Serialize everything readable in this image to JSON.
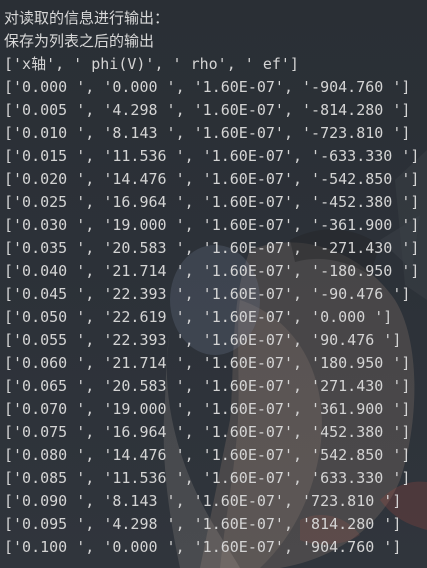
{
  "console": {
    "intro_lines": [
      "对读取的信息进行输出：",
      "保存为列表之后的输出"
    ],
    "rows": [
      "['x轴', ' phi(V)', ' rho', ' ef']",
      "['0.000 ', '0.000 ', '1.60E-07', '-904.760 ']",
      "['0.005 ', '4.298 ', '1.60E-07', '-814.280 ']",
      "['0.010 ', '8.143 ', '1.60E-07', '-723.810 ']",
      "['0.015 ', '11.536 ', '1.60E-07', '-633.330 ']",
      "['0.020 ', '14.476 ', '1.60E-07', '-542.850 ']",
      "['0.025 ', '16.964 ', '1.60E-07', '-452.380 ']",
      "['0.030 ', '19.000 ', '1.60E-07', '-361.900 ']",
      "['0.035 ', '20.583 ', '1.60E-07', '-271.430 ']",
      "['0.040 ', '21.714 ', '1.60E-07', '-180.950 ']",
      "['0.045 ', '22.393 ', '1.60E-07', '-90.476 ']",
      "['0.050 ', '22.619 ', '1.60E-07', '0.000 ']",
      "['0.055 ', '22.393 ', '1.60E-07', '90.476 ']",
      "['0.060 ', '21.714 ', '1.60E-07', '180.950 ']",
      "['0.065 ', '20.583 ', '1.60E-07', '271.430 ']",
      "['0.070 ', '19.000 ', '1.60E-07', '361.900 ']",
      "['0.075 ', '16.964 ', '1.60E-07', '452.380 ']",
      "['0.080 ', '14.476 ', '1.60E-07', '542.850 ']",
      "['0.085 ', '11.536 ', '1.60E-07', '633.330 ']",
      "['0.090 ', '8.143 ', '1.60E-07', '723.810 ']",
      "['0.095 ', '4.298 ', '1.60E-07', '814.280 ']",
      "['0.100 ', '0.000 ', '1.60E-07', '904.760 ']"
    ]
  },
  "colors": {
    "background": "#2b3036",
    "text": "#d4d4d4"
  }
}
